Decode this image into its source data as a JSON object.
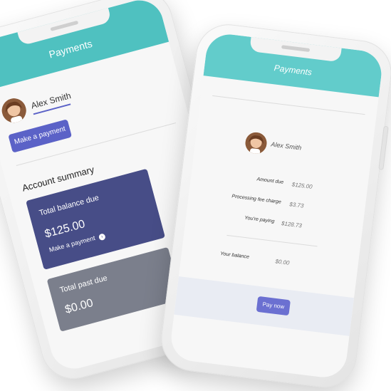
{
  "phone_left": {
    "header_title": "Payments",
    "user_name": "Alex Smith",
    "make_payment_button": "Make a payment",
    "section_title": "Account summary",
    "total_balance_label": "Total balance due",
    "total_balance_amount": "$125.00",
    "total_balance_link": "Make a payment",
    "past_due_label": "Total past due",
    "past_due_amount": "$0.00"
  },
  "phone_right": {
    "header_title": "Payments",
    "user_name": "Alex Smith",
    "rows": [
      {
        "label": "Amount due",
        "value": "$125.00"
      },
      {
        "label": "Processing fee charge",
        "value": "$3.73"
      },
      {
        "label": "You're paying",
        "value": "$128.73"
      }
    ],
    "balance_label": "Your balance",
    "balance_value": "$0.00",
    "pay_button": "Pay now"
  },
  "colors": {
    "header": "#4fc1c0",
    "accent": "#5b62c7",
    "balance_card": "#474d87",
    "past_due_card": "#7b7f8c"
  }
}
